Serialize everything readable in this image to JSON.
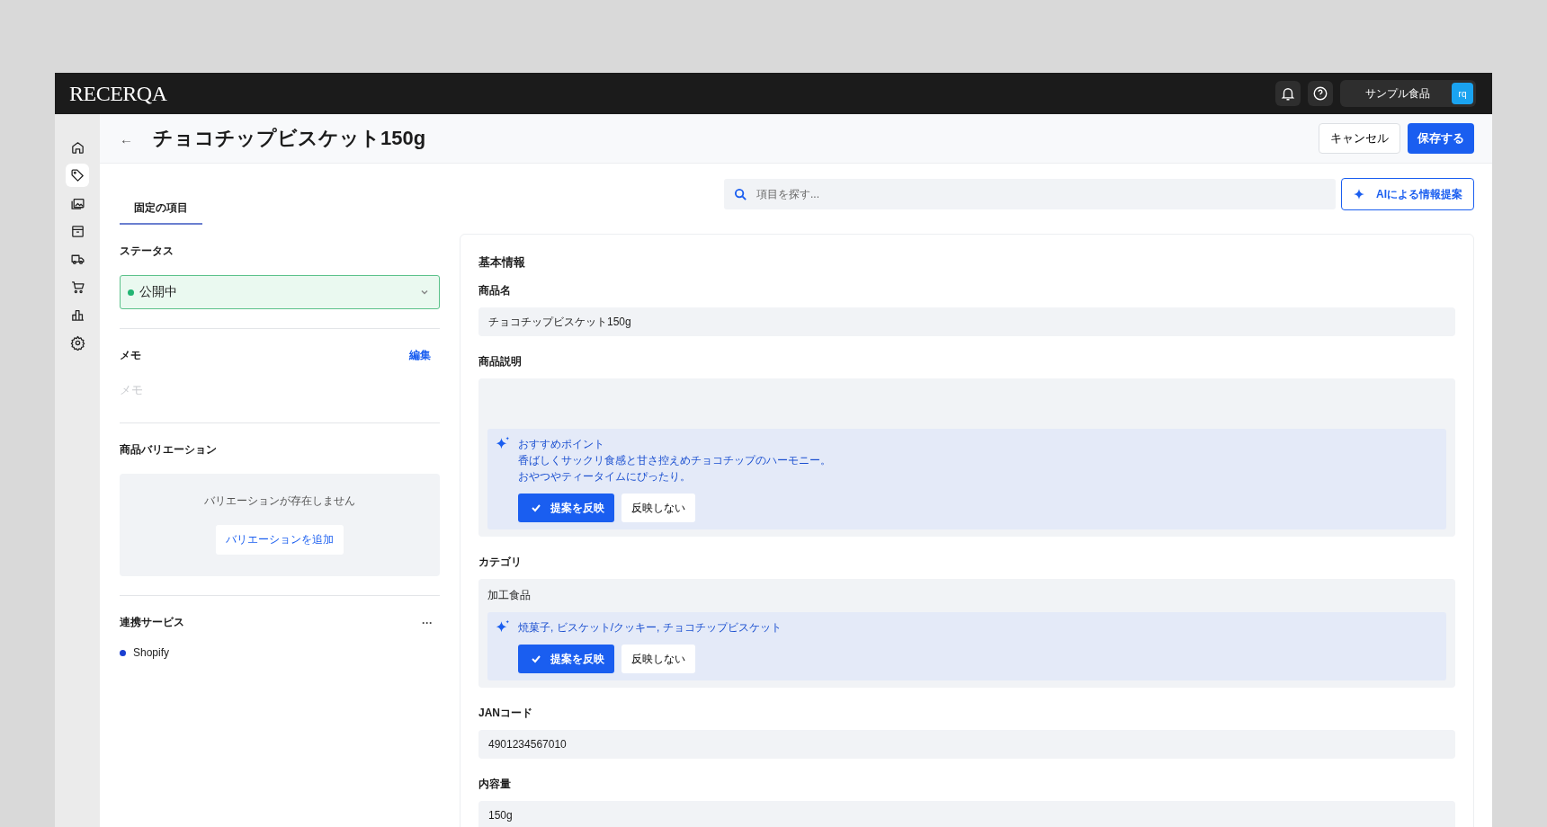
{
  "topbar": {
    "logo": "RECERQA",
    "account": {
      "name": "サンプル食品",
      "avatar": "rq"
    }
  },
  "nav": [
    {
      "kind": "home",
      "selected": false
    },
    {
      "kind": "tag",
      "selected": true
    },
    {
      "kind": "images",
      "selected": false
    },
    {
      "kind": "archive",
      "selected": false
    },
    {
      "kind": "truck",
      "selected": false
    },
    {
      "kind": "cart",
      "selected": false
    },
    {
      "kind": "chart",
      "selected": false
    },
    {
      "kind": "gear",
      "selected": false
    }
  ],
  "header": {
    "back": "←",
    "title": "チョコチップビスケット150g",
    "cancel": "キャンセル",
    "save": "保存する"
  },
  "tabs": [
    {
      "label": "固定の項目",
      "selected": true
    }
  ],
  "search": {
    "placeholder": "項目を探す..."
  },
  "ai_button": "AIによる情報提案",
  "left": {
    "status": {
      "label": "ステータス",
      "value": "公開中"
    },
    "memo": {
      "label": "メモ",
      "edit": "編集",
      "placeholder": "メモ"
    },
    "variations": {
      "label": "商品バリエーション",
      "empty": "バリエーションが存在しません",
      "add": "バリエーションを追加"
    },
    "services": {
      "label": "連携サービス",
      "menu": "···",
      "items": [
        {
          "name": "Shopify",
          "color": "#1a3fd1"
        }
      ]
    }
  },
  "basic_info": {
    "title": "基本情報",
    "fields": [
      {
        "kind": "text",
        "label": "商品名",
        "value": "チョコチップビスケット150g"
      },
      {
        "kind": "suggest",
        "label": "商品説明",
        "suggestion": [
          "おすすめポイント",
          "香ばしくサックリ食感と甘さ控えめチョコチップのハーモニー。",
          "おやつやティータイムにぴったり。"
        ],
        "accept": "提案を反映",
        "reject": "反映しない"
      },
      {
        "kind": "suggest",
        "label": "カテゴリ",
        "value": "加工食品",
        "suggestion": [
          "焼菓子, ビスケット/クッキー, チョコチップビスケット"
        ],
        "accept": "提案を反映",
        "reject": "反映しない"
      },
      {
        "kind": "text",
        "label": "JANコード",
        "value": "4901234567010"
      },
      {
        "kind": "text",
        "label": "内容量",
        "value": "150g"
      }
    ]
  }
}
